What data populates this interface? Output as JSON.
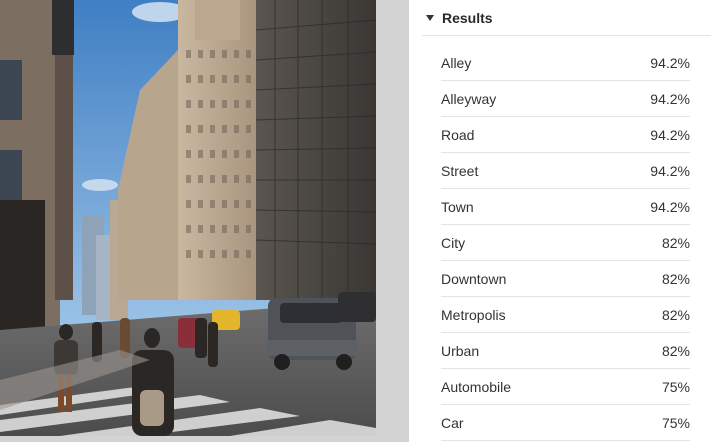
{
  "results_panel": {
    "title": "Results",
    "items": [
      {
        "label": "Alley",
        "confidence": "94.2%"
      },
      {
        "label": "Alleyway",
        "confidence": "94.2%"
      },
      {
        "label": "Road",
        "confidence": "94.2%"
      },
      {
        "label": "Street",
        "confidence": "94.2%"
      },
      {
        "label": "Town",
        "confidence": "94.2%"
      },
      {
        "label": "City",
        "confidence": "82%"
      },
      {
        "label": "Downtown",
        "confidence": "82%"
      },
      {
        "label": "Metropolis",
        "confidence": "82%"
      },
      {
        "label": "Urban",
        "confidence": "82%"
      },
      {
        "label": "Automobile",
        "confidence": "75%"
      },
      {
        "label": "Car",
        "confidence": "75%"
      }
    ]
  },
  "colors": {
    "sky": "#5b8fc9",
    "gutter": "#d3d3d3",
    "divider": "#e4e4e4",
    "text": "#333333"
  }
}
